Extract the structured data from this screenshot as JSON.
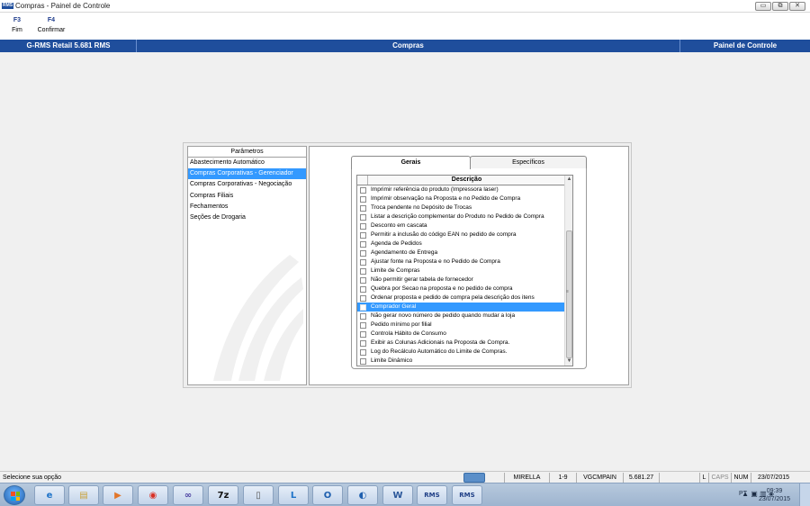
{
  "window": {
    "app_icon_text": "RMS",
    "title": "Compras - Painel de Controle",
    "buttons": {
      "minimize": "▭",
      "restore": "⧉",
      "close": "✕"
    }
  },
  "function_keys": [
    {
      "key": "F3",
      "label": "Fim"
    },
    {
      "key": "F4",
      "label": "Confirmar"
    }
  ],
  "header": {
    "left": "G-RMS Retail 5.681 RMS",
    "center": "Compras",
    "right": "Painel de Controle",
    "color": "#1f4e9c"
  },
  "parametros": {
    "title": "Parâmetros",
    "items": [
      "Abastecimento Automático",
      "Compras Corporativas - Gerenciador",
      "Compras Corporativas - Negociação",
      "Compras Filiais",
      "Fechamentos",
      "Seções de Drogaria"
    ],
    "selected_index": 1
  },
  "tabs": [
    {
      "label": "Gerais",
      "active": true
    },
    {
      "label": "Específicos",
      "active": false
    }
  ],
  "grid": {
    "column_header": "Descrição",
    "rows": [
      "Imprimir referência do produto (Impressora laser)",
      "Imprimir observação na Proposta e no Pedido de Compra",
      "Troca pendente no Depósito de Trocas",
      "Listar a descrição complementar do Produto no Pedido de Compra",
      "Desconto em cascata",
      "Permitir a inclusão do código EAN no pedido de compra",
      "Agenda de Pedidos",
      "Agendamento de Entrega",
      "Ajustar fonte na Proposta e no Pedido de Compra",
      "Limite de Compras",
      "Não permitir gerar tabela de fornecedor",
      "Quebra por Secao na proposta e no pedido de compra",
      "Ordenar proposta e pedido de compra pela descrição dos itens",
      "Comprador Geral",
      "Não gerar novo número de pedido quando mudar a loja",
      "Pedido mínimo por filial",
      "Controla Hábito de Consumo",
      "Exibir as Colunas Adicionais na Proposta de Compra.",
      "Log do Recálculo Automático do Limite de Compras.",
      "Limite Dinâmico"
    ],
    "selected_index": 13,
    "scroll_up": "▲",
    "scroll_down": "▼",
    "scroll_grip": "≡"
  },
  "statusbar": {
    "message": "Selecione sua opção",
    "user": "MIRELLA",
    "range": "1-9",
    "program": "VGCMPAIN",
    "version": "5.681.27",
    "caps_l": "L",
    "caps": "CAPS",
    "num": "NUM",
    "date": "23/07/2015"
  },
  "taskbar": {
    "apps": [
      {
        "name": "internet-explorer",
        "glyph": "e",
        "color": "#1e73c8"
      },
      {
        "name": "file-explorer",
        "glyph": "▤",
        "color": "#c9a23a"
      },
      {
        "name": "media-player",
        "glyph": "▶",
        "color": "#e2762a"
      },
      {
        "name": "chrome",
        "glyph": "◉",
        "color": "#d93025"
      },
      {
        "name": "network-app",
        "glyph": "∞",
        "color": "#4a3fa0"
      },
      {
        "name": "7zip",
        "glyph": "7z",
        "color": "#111111"
      },
      {
        "name": "blank-document",
        "glyph": "▯",
        "color": "#555555"
      },
      {
        "name": "lync",
        "glyph": "L",
        "color": "#1e73c8"
      },
      {
        "name": "outlook",
        "glyph": "O",
        "color": "#1e5fae"
      },
      {
        "name": "remote-app",
        "glyph": "◐",
        "color": "#1e5fae"
      },
      {
        "name": "word",
        "glyph": "W",
        "color": "#2b579a"
      },
      {
        "name": "rms-1",
        "glyph": "RMS",
        "color": "#1f3f86"
      },
      {
        "name": "rms-2",
        "glyph": "RMS",
        "color": "#1f3f86"
      }
    ],
    "language": "PT",
    "time": "09:39",
    "date": "23/07/2015"
  }
}
